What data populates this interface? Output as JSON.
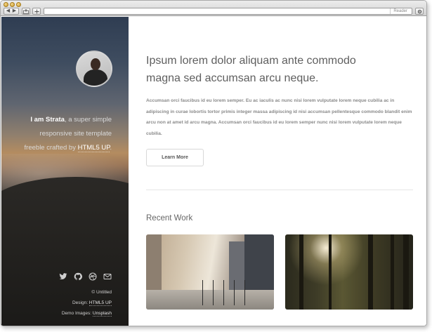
{
  "browser": {
    "back": "◀",
    "forward": "▶",
    "reader": "Reader"
  },
  "sidebar": {
    "intro": {
      "name": "I am Strata",
      "text1": ", a super simple",
      "line2": "responsive site template",
      "line3a": "freeble crafted by ",
      "link": "HTML5 UP",
      "line3b": "."
    },
    "social_icons": [
      "twitter-icon",
      "github-icon",
      "dribbble-icon",
      "envelope-icon"
    ],
    "footer": {
      "copyright": "© Untitled",
      "design_prefix": "Design: ",
      "design_link": "HTML5 UP",
      "images_prefix": "Demo Images: ",
      "images_link": "Unsplash"
    }
  },
  "main": {
    "headline_line1": "Ipsum lorem dolor aliquam ante commodo",
    "headline_line2": "magna sed accumsan arcu neque.",
    "paragraph": "Accumsan orci faucibus id eu lorem semper. Eu ac iaculis ac nunc nisi lorem vulputate lorem neque cubilia ac in adipiscing in curae lobortis tortor primis integer massa adipiscing id nisi accumsan pellentesque commodo blandit enim arcu non at amet id arcu magna. Accumsan orci faucibus id eu lorem semper nunc nisi lorem vulputate lorem neque cubilia.",
    "button": "Learn More",
    "section_title": "Recent Work"
  }
}
